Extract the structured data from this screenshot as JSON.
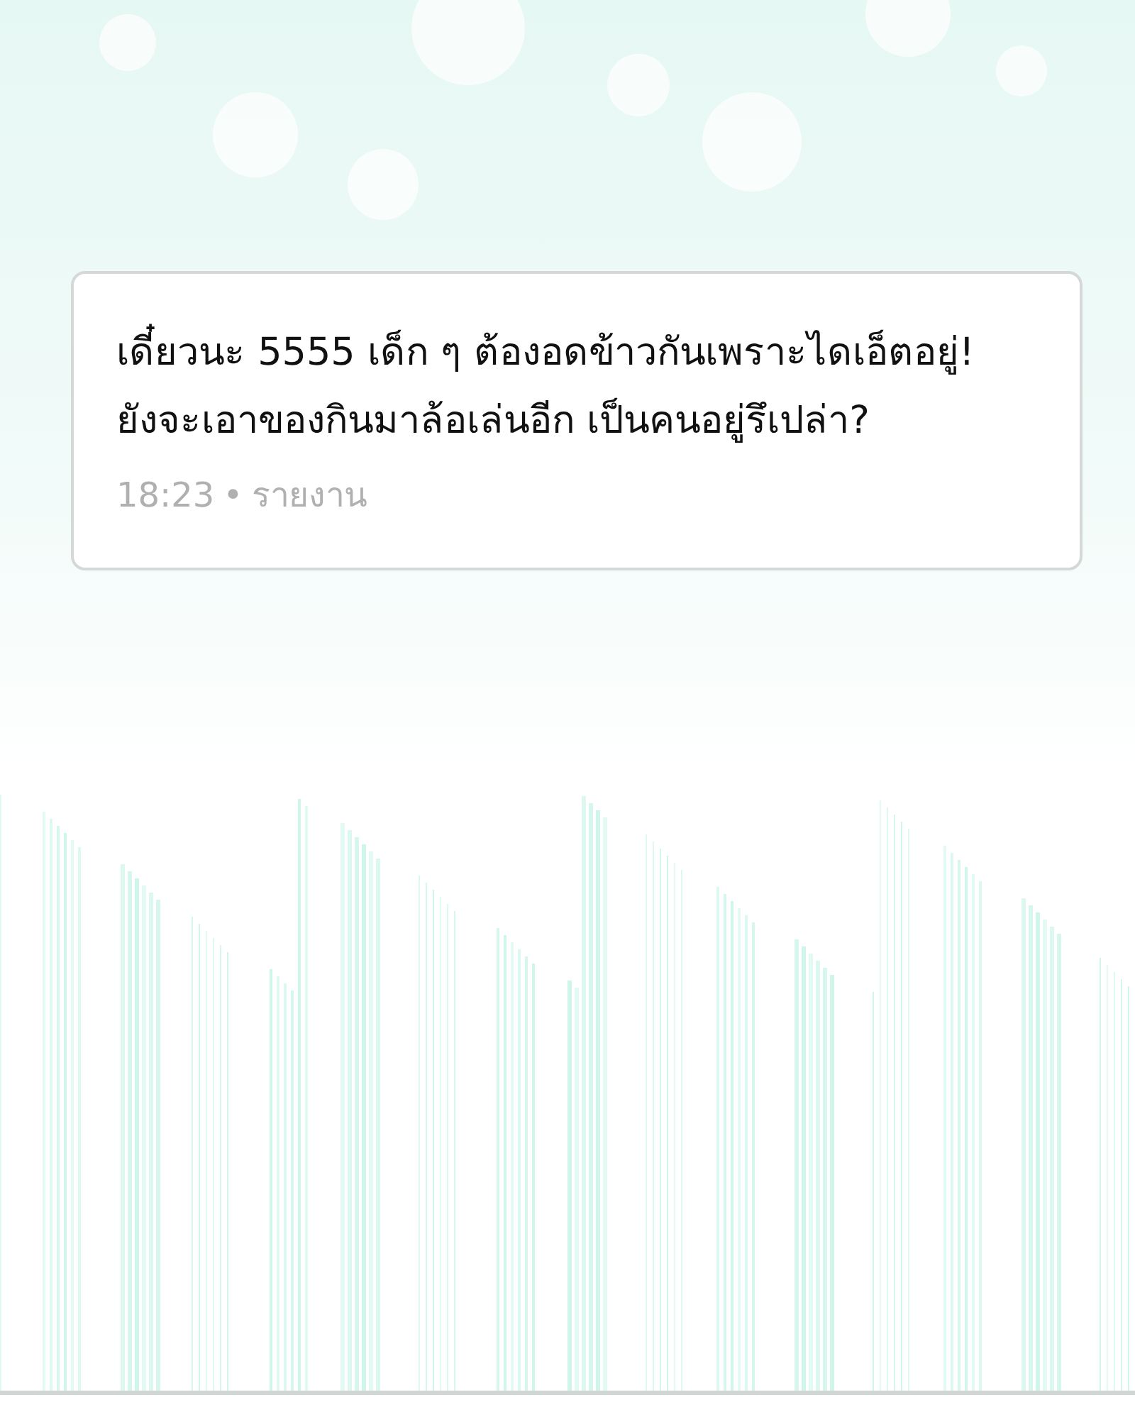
{
  "message": {
    "lines": [
      "เดี๋ยวนะ 5555 เด็ก ๆ ต้องอดข้าวกันเพราะไดเอ็ตอยู่!",
      "ยังจะเอาของกินมาล้อเล่นอีก เป็นคนอยู่รึเปล่า?"
    ],
    "time": "18:23",
    "separator": "•",
    "report_link": "รายงาน"
  }
}
